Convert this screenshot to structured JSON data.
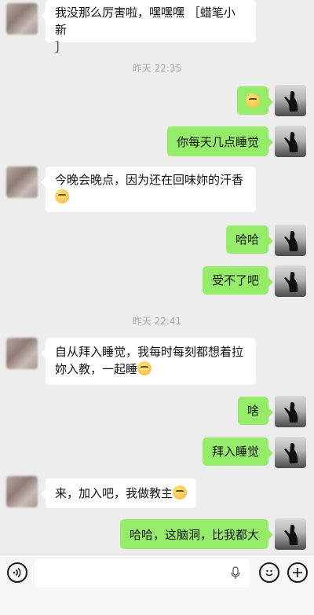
{
  "messages": [
    {
      "side": "left",
      "text": "我没那么厉害啦，嘿嘿嘿 ［蜡笔小新］"
    },
    {
      "time": "昨天 22:35"
    },
    {
      "side": "right",
      "text": "😊"
    },
    {
      "side": "right",
      "text": "你每天几点睡觉"
    },
    {
      "side": "left",
      "text": "今晚会晚点，因为还在回味妳的汗香"
    },
    {
      "side": "right",
      "text": "哈哈"
    },
    {
      "side": "right",
      "text": "受不了吧"
    },
    {
      "time": "昨天 22:41"
    },
    {
      "side": "left",
      "text": "自从拜入睡觉，我每时每刻都想着拉 妳入教，一起睡"
    },
    {
      "side": "right",
      "text": "啥"
    },
    {
      "side": "right",
      "text": "拜入睡觉"
    },
    {
      "side": "left",
      "text": "来，加入吧，我做教主"
    },
    {
      "side": "right",
      "text": "哈哈，这脑洞，比我都大"
    }
  ],
  "chat": {
    "m1_line1": "我没那么厉害啦，嘿嘿嘿 ［蜡笔小新",
    "m1_line2": "］",
    "time1": "昨天 22:35",
    "m3": "你每天几点睡觉",
    "m4": "今晚会晚点，因为还在回味妳的汗香",
    "m5": "哈哈",
    "m6": "受不了吧",
    "time2": "昨天 22:41",
    "m7_line1": "自从拜入睡觉，我每时每刻都想着拉",
    "m7_line2": "妳入教，一起睡",
    "m8": "啥",
    "m9": "拜入睡觉",
    "m10": "来，加入吧，我做教主",
    "m11": "哈哈，这脑洞，比我都大"
  },
  "input_bar": {
    "voice_icon": "voice-icon",
    "mic_icon": "mic-icon",
    "emoji_icon": "emoji-icon",
    "plus_icon": "plus-icon"
  },
  "colors": {
    "background": "#ededed",
    "bubble_self": "#95ec69",
    "bubble_other": "#ffffff",
    "timestamp": "#a8a8a8"
  }
}
